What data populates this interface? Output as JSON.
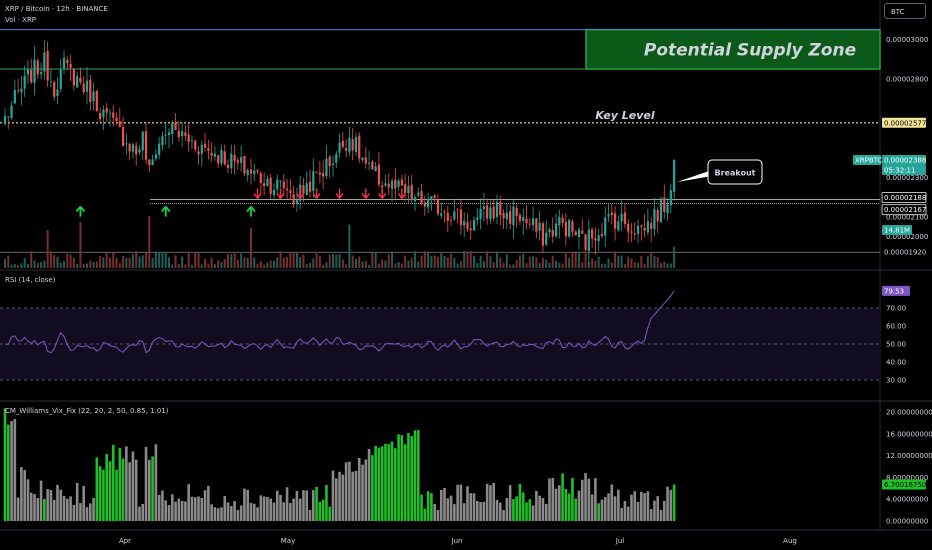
{
  "header": {
    "title": "XRP / Bitcoin · 12h · BINANCE",
    "volume_label": "Vol · XRP",
    "currency": "BTC"
  },
  "annotations": {
    "supply_zone": "Potential Supply Zone",
    "key_level": "Key Level",
    "breakout": "Breakout"
  },
  "rsi": {
    "label": "RSI (14, close)",
    "value": "79.53"
  },
  "cm": {
    "label": "CM_Williams_Vix_Fix (22, 20, 2, 50, 0.85, 1.01)",
    "value": "6.70016750"
  },
  "price_tags": {
    "symbol": "XRPBTC",
    "last": "0.00002388",
    "countdown": "05:32:11",
    "level_high": "0.00002188",
    "level_low": "0.00002167",
    "key": "0.00002577",
    "support": "0.00001920",
    "volume": "14.81M"
  },
  "colors": {
    "up": "#26a69a",
    "down": "#ef5350",
    "zone": "#0b5a1a",
    "zone_border": "#1fa83a",
    "key_level": "#f3e39a",
    "rsi_line": "#7e57c2",
    "vix_green": "#1fbf27",
    "vix_gray": "#8a8a8a",
    "arrow_up": "#18d23f",
    "arrow_down": "#ef3340"
  },
  "chart_data": [
    {
      "type": "candlestick",
      "title": "XRP / Bitcoin · 12h · BINANCE",
      "ylim": [
        1.84e-05,
        3.18e-05
      ],
      "y_ticks": [
        "0.00003000",
        "0.00002800",
        "0.00002577",
        "0.00002300",
        "0.00002188",
        "0.00002167",
        "0.00002100",
        "0.00002000",
        "0.00001920"
      ],
      "x_ticks": [
        "Apr",
        "May",
        "Jun",
        "Jul",
        "Aug"
      ],
      "levels": {
        "supply_zone": [
          2.85e-05,
          3.05e-05
        ],
        "key_level": 2.577e-05,
        "upper_line": 3.05e-05,
        "lower_zone_line": 2.85e-05,
        "breakout_high": 2.188e-05,
        "breakout_low": 2.167e-05,
        "support": 1.92e-05
      },
      "close_anchors": [
        [
          0,
          2.6e-05
        ],
        [
          4,
          2.72e-05
        ],
        [
          8,
          2.83e-05
        ],
        [
          12,
          2.88e-05
        ],
        [
          15,
          2.76e-05
        ],
        [
          18,
          2.86e-05
        ],
        [
          22,
          2.8e-05
        ],
        [
          26,
          2.73e-05
        ],
        [
          30,
          2.62e-05
        ],
        [
          34,
          2.55e-05
        ],
        [
          38,
          2.47e-05
        ],
        [
          40,
          2.43e-05
        ],
        [
          42,
          2.5e-05
        ],
        [
          44,
          2.32e-05
        ],
        [
          46,
          2.45e-05
        ],
        [
          50,
          2.55e-05
        ],
        [
          54,
          2.51e-05
        ],
        [
          58,
          2.47e-05
        ],
        [
          62,
          2.44e-05
        ],
        [
          66,
          2.41e-05
        ],
        [
          70,
          2.37e-05
        ],
        [
          74,
          2.34e-05
        ],
        [
          78,
          2.3e-05
        ],
        [
          82,
          2.26e-05
        ],
        [
          86,
          2.25e-05
        ],
        [
          88,
          2.19e-05
        ],
        [
          92,
          2.26e-05
        ],
        [
          96,
          2.32e-05
        ],
        [
          100,
          2.4e-05
        ],
        [
          103,
          2.47e-05
        ],
        [
          105,
          2.51e-05
        ],
        [
          108,
          2.42e-05
        ],
        [
          111,
          2.33e-05
        ],
        [
          114,
          2.29e-05
        ],
        [
          118,
          2.25e-05
        ],
        [
          122,
          2.22e-05
        ],
        [
          126,
          2.18e-05
        ],
        [
          130,
          2.16e-05
        ],
        [
          134,
          2.14e-05
        ],
        [
          138,
          2.1e-05
        ],
        [
          141,
          2.06e-05
        ],
        [
          144,
          2.08e-05
        ],
        [
          147,
          2.12e-05
        ],
        [
          150,
          2.14e-05
        ],
        [
          153,
          2.1e-05
        ],
        [
          156,
          2.12e-05
        ],
        [
          159,
          2.07e-05
        ],
        [
          162,
          2.03e-05
        ],
        [
          164,
          2e-05
        ],
        [
          166,
          2.02e-05
        ],
        [
          169,
          2.07e-05
        ],
        [
          172,
          2.04e-05
        ],
        [
          175,
          2e-05
        ],
        [
          177,
          1.97e-05
        ],
        [
          179,
          2.01e-05
        ],
        [
          182,
          2.05e-05
        ],
        [
          185,
          2.1e-05
        ],
        [
          188,
          2.08e-05
        ],
        [
          191,
          2.05e-05
        ],
        [
          194,
          2.04e-05
        ],
        [
          196,
          2.06e-05
        ],
        [
          198,
          2.1e-05
        ],
        [
          200,
          2.14e-05
        ],
        [
          202,
          2.19e-05
        ],
        [
          203,
          2.28e-05
        ],
        [
          204,
          2.39e-05
        ]
      ],
      "up_arrows_at": [
        23,
        49,
        75
      ],
      "down_arrows_at": [
        77,
        84,
        90,
        95,
        102,
        110,
        115,
        121
      ]
    },
    {
      "type": "line",
      "title": "RSI (14, close)",
      "ylim": [
        20,
        90
      ],
      "y_ticks": [
        "70.00",
        "60.00",
        "50.00",
        "40.00",
        "30.00"
      ],
      "bands": [
        30,
        50,
        70
      ],
      "last": 79.53
    },
    {
      "type": "bar",
      "title": "CM_Williams_Vix_Fix (22, 20, 2, 50, 0.85, 1.01)",
      "ylim": [
        0,
        21.5
      ],
      "y_ticks": [
        "20.00000000",
        "16.00000000",
        "12.00000000",
        "8.00000000",
        "4.00000000",
        "0.00000000"
      ],
      "last": 6.7001675
    }
  ]
}
